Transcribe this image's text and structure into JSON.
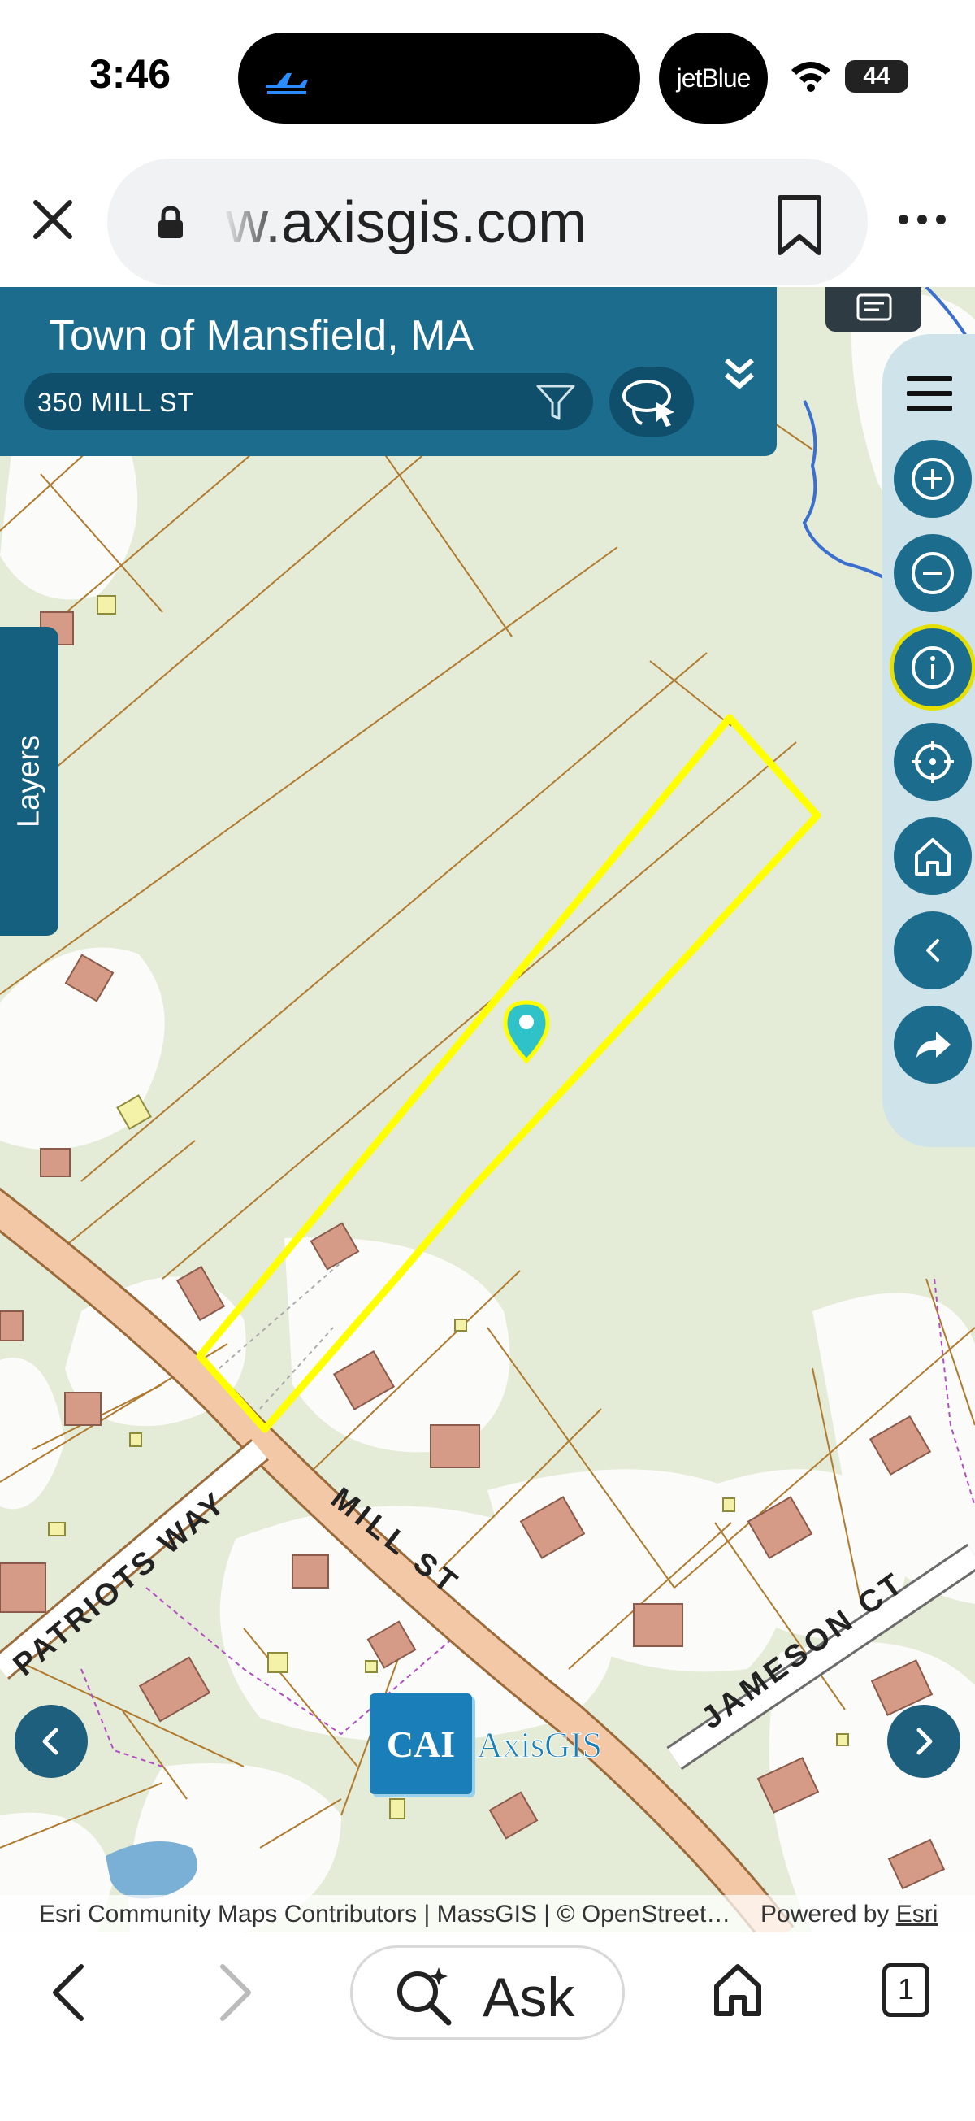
{
  "status_bar": {
    "time": "3:46",
    "carrier_pill": "jetBlue",
    "battery": "44",
    "icons": [
      "plane-icon",
      "wifi-icon",
      "battery-icon"
    ]
  },
  "browser": {
    "url": "w.axisgis.com",
    "actions": [
      "close-icon",
      "lock-icon",
      "bookmark-icon",
      "share-icon",
      "more-icon"
    ]
  },
  "map_header": {
    "title": "Town of Mansfield, MA",
    "search_value": "350 MILL ST",
    "icons": [
      "filter-icon",
      "lasso-select-icon",
      "collapse-chevron-icon",
      "chat-icon"
    ]
  },
  "layers_tab": {
    "label": "Layers"
  },
  "toolbar": {
    "buttons": [
      "menu-icon",
      "zoom-in-icon",
      "zoom-out-icon",
      "info-icon",
      "locate-icon",
      "home-icon",
      "collapse-icon",
      "share-arrow-icon"
    ],
    "active_button": "info-icon"
  },
  "map_labels": {
    "street_1": "PATRIOTS WAY",
    "street_2": "MILL ST",
    "street_3": "JAMESON CT"
  },
  "logo": {
    "box_text": "CAI",
    "text": "AxisGIS"
  },
  "attribution": {
    "left": "Esri Community Maps Contributors | MassGIS | © OpenStreet…",
    "right_prefix": "Powered by ",
    "right_link": "Esri"
  },
  "bottom_nav": {
    "ask_label": "Ask",
    "tab_count": "1"
  },
  "colors": {
    "header": "#1c6c8d",
    "parcel_highlight": "#ffff00",
    "road": "#f2c8a6",
    "land": "#e4ebd6"
  }
}
